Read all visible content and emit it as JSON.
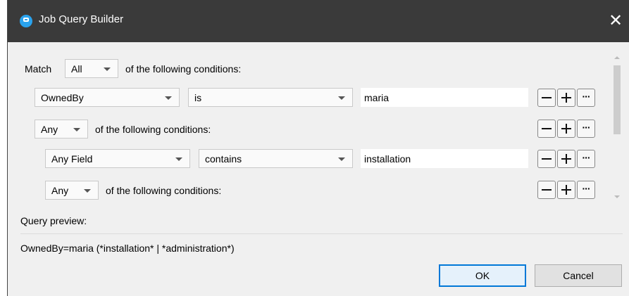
{
  "window": {
    "title": "Job Query Builder",
    "icon": "app-icon",
    "close_label": "✕"
  },
  "match_row": {
    "label": "Match",
    "value": "All",
    "suffix": "of the following conditions:"
  },
  "conditions": [
    {
      "field": "OwnedBy",
      "operator": "is",
      "value": "maria"
    },
    {
      "group_value": "Any",
      "group_suffix": "of the following conditions:"
    },
    {
      "field": "Any Field",
      "operator": "contains",
      "value": "installation"
    },
    {
      "group_value": "Any",
      "group_suffix": "of the following conditions:"
    }
  ],
  "row_buttons": {
    "minus_icon": "minus-icon",
    "plus_icon": "plus-icon",
    "more_label": "···"
  },
  "preview": {
    "label": "Query preview:",
    "text": "OwnedBy=maria (*installation* | *administration*)"
  },
  "buttons": {
    "ok": "OK",
    "cancel": "Cancel"
  },
  "colors": {
    "titlebar": "#3a3a3a",
    "accent": "#0078d7",
    "icon": "#2aa3ee"
  }
}
